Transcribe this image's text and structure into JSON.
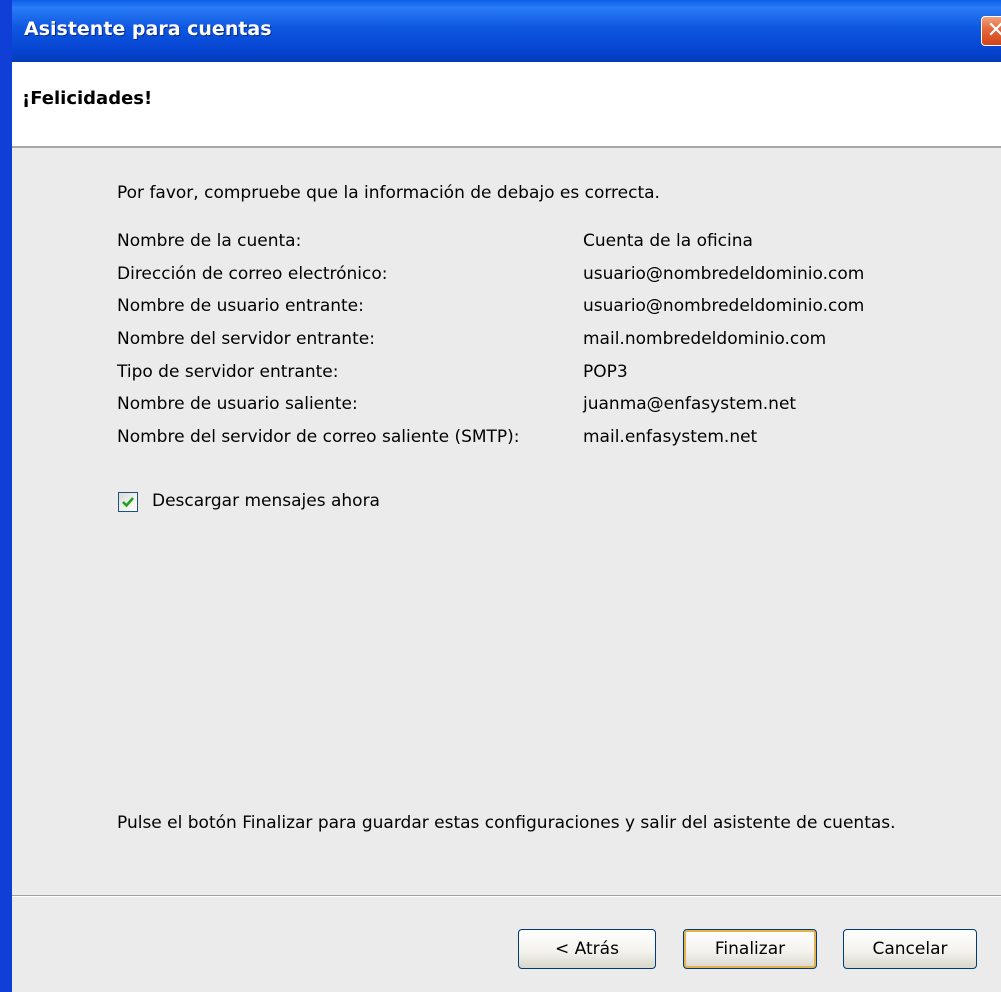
{
  "window": {
    "title": "Asistente para cuentas",
    "close_glyph": "✕"
  },
  "header": {
    "title": "¡Felicidades!"
  },
  "content": {
    "instructions": "Por favor, compruebe que la información de debajo es correcta.",
    "details": [
      {
        "label": "Nombre de la cuenta:",
        "value": "Cuenta de la oficina"
      },
      {
        "label": "Dirección de correo electrónico:",
        "value": "usuario@nombredeldominio.com"
      },
      {
        "label": "Nombre de usuario entrante:",
        "value": "usuario@nombredeldominio.com"
      },
      {
        "label": "Nombre del servidor entrante:",
        "value": "mail.nombredeldominio.com"
      },
      {
        "label": "Tipo de servidor entrante:",
        "value": "POP3"
      },
      {
        "label": "Nombre de usuario saliente:",
        "value": "juanma@enfasystem.net"
      },
      {
        "label": "Nombre del servidor de correo saliente (SMTP):",
        "value": "mail.enfasystem.net"
      }
    ],
    "download_checkbox": {
      "label": "Descargar mensajes ahora",
      "checked": true
    },
    "footer_note": "Pulse el botón Finalizar para guardar estas configuraciones y salir del asistente de cuentas."
  },
  "buttons": {
    "back": "< Atrás",
    "finish": "Finalizar",
    "cancel": "Cancelar"
  },
  "colors": {
    "titlebar": "#0645d2",
    "close_button": "#e56b3e",
    "dialog_background": "#ebebeb"
  },
  "icons": {
    "close": "close-icon",
    "check": "checkmark-icon"
  }
}
